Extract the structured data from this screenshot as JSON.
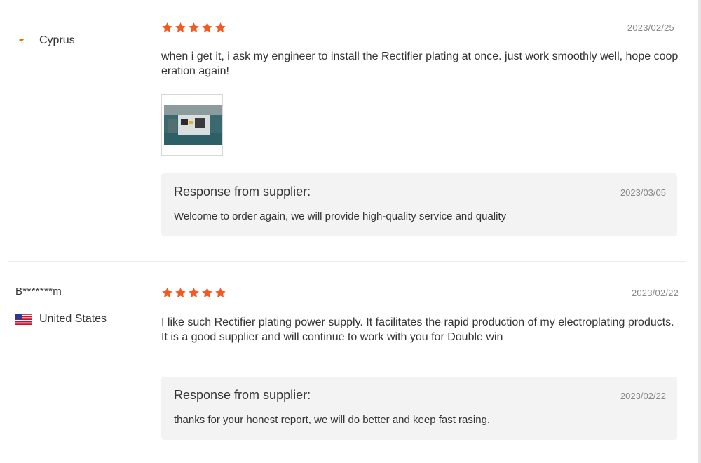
{
  "reviews": [
    {
      "buyer": "",
      "country": "Cyprus",
      "rating": 5,
      "date": "2023/02/25",
      "comment": "when i get it, i ask my engineer to install the Rectifier plating at once. just work smoothly well, hope cooperation again!",
      "has_photo": true,
      "response": {
        "title": "Response from supplier:",
        "date": "2023/03/05",
        "text": "Welcome to order again, we will provide high-quality service and quality"
      }
    },
    {
      "buyer": "B*******m",
      "country": "United States",
      "rating": 5,
      "date": "2023/02/22",
      "comment": "I like such Rectifier plating power supply. It facilitates the rapid production of my electroplating products. It is a good supplier and will continue to work with you for Double win",
      "response": {
        "title": "Response from supplier:",
        "date": "2023/02/22",
        "text": "thanks for your honest report, we will do better and keep fast rasing."
      }
    }
  ],
  "colors": {
    "star": "#f15a22",
    "response_bg": "#f3f3f3",
    "date_text": "#888888"
  },
  "icons": [
    "cyprus-flag-icon",
    "us-flag-icon",
    "star-icon"
  ]
}
